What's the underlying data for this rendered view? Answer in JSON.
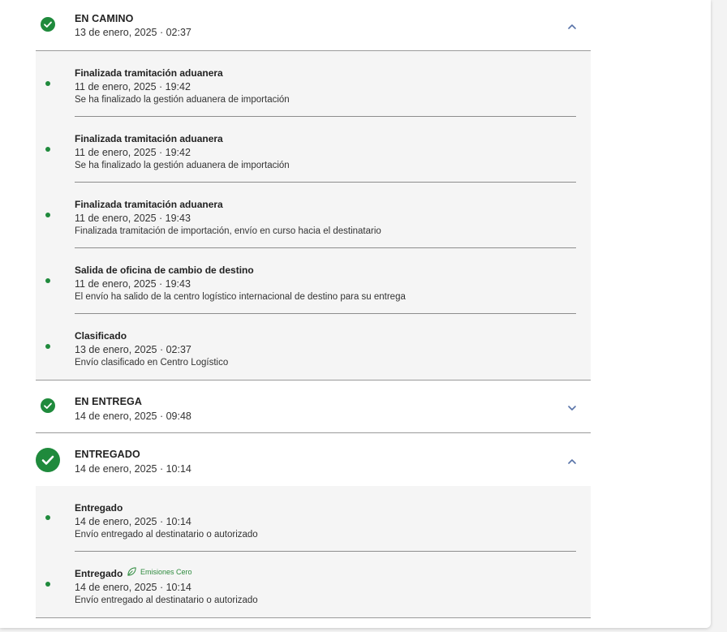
{
  "stages": [
    {
      "title": "EN CAMINO",
      "date": "13 de enero, 2025 · 02:37",
      "expanded": true,
      "events": [
        {
          "title": "Finalizada tramitación aduanera",
          "date": "11 de enero, 2025 · 19:42",
          "desc": "Se ha finalizado la gestión aduanera de importación"
        },
        {
          "title": "Finalizada tramitación aduanera",
          "date": "11 de enero, 2025 · 19:42",
          "desc": "Se ha finalizado la gestión aduanera de importación"
        },
        {
          "title": "Finalizada tramitación aduanera",
          "date": "11 de enero, 2025 · 19:43",
          "desc": "Finalizada tramitación de importación, envío en curso hacia el destinatario"
        },
        {
          "title": "Salida de oficina de cambio de destino",
          "date": "11 de enero, 2025 · 19:43",
          "desc": "El envío ha salido de la centro logístico internacional de destino para su entrega"
        },
        {
          "title": "Clasificado",
          "date": "13 de enero, 2025 · 02:37",
          "desc": "Envío clasificado en Centro Logístico"
        }
      ]
    },
    {
      "title": "EN ENTREGA",
      "date": "14 de enero, 2025 · 09:48",
      "expanded": false,
      "events": []
    },
    {
      "title": "ENTREGADO",
      "date": "14 de enero, 2025 · 10:14",
      "expanded": true,
      "events": [
        {
          "title": "Entregado",
          "date": "14 de enero, 2025 · 10:14",
          "desc": "Envío entregado al destinatario o autorizado"
        },
        {
          "title": "Entregado",
          "date": "14 de enero, 2025 · 10:14",
          "desc": "Envío entregado al destinatario o autorizado",
          "badge": "Emisiones Cero"
        }
      ]
    }
  ],
  "icons": {
    "check": "check-icon",
    "chevron_up": "chevron-up-icon",
    "chevron_down": "chevron-down-icon",
    "leaf": "leaf-icon"
  },
  "colors": {
    "green": "#1f8a3c",
    "timeline": "#7ac27c",
    "chevron": "#5873a8",
    "badge": "#2e8b3e",
    "events_bg": "#f5f5f5"
  }
}
